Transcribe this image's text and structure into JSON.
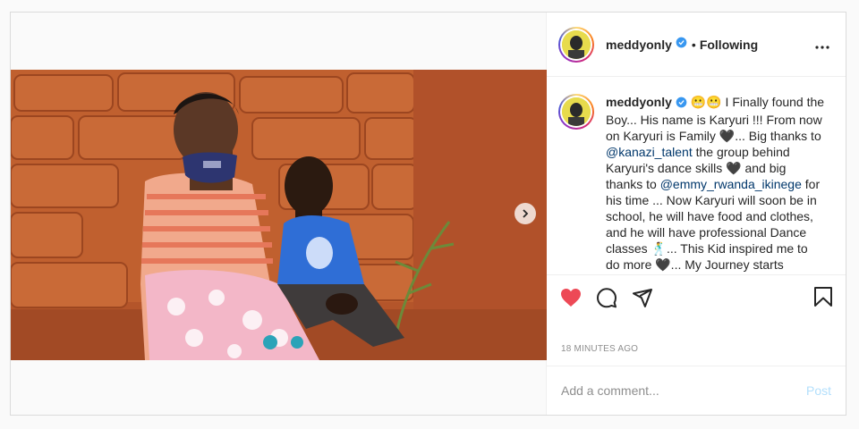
{
  "post": {
    "author": "meddyonly",
    "follow_status": "Following",
    "separator": "•",
    "timestamp": "18 MINUTES AGO",
    "comment_placeholder": "Add a comment...",
    "post_label": "Post"
  },
  "caption": {
    "author": "meddyonly",
    "seg1": " 😬😬 I Finally found the Boy... His name is Karyuri !!! From now on Karyuri is Family 🖤... Big thanks to ",
    "mention1": "@kanazi_talent",
    "seg2": " the group behind Karyuri's dance skills 🖤 and big thanks to ",
    "mention2": "@emmy_rwanda_ikinege",
    "seg3": " for his time ... Now Karyuri will soon be in school, he will have food and clothes, and he will have professional Dance classes 🕺... This Kid inspired me to do more 🖤... My Journey starts"
  },
  "icons": {
    "verified": "verified-badge-icon",
    "more": "more-options-icon",
    "like": "heart-icon",
    "comment": "comment-bubble-icon",
    "share": "paper-plane-icon",
    "save": "bookmark-icon",
    "next": "chevron-right-icon"
  },
  "colors": {
    "like_active": "#ed4956",
    "verified": "#3897f0",
    "mention": "#00376b",
    "post_disabled": "#b2dffc"
  }
}
